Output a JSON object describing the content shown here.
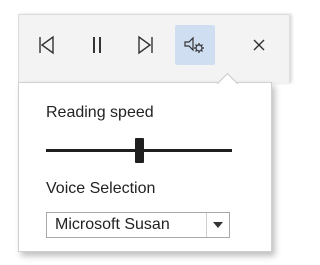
{
  "toolbar": {
    "buttons": [
      {
        "icon": "previous-icon",
        "label": "Previous"
      },
      {
        "icon": "pause-icon",
        "label": "Pause"
      },
      {
        "icon": "next-icon",
        "label": "Next"
      },
      {
        "icon": "voice-settings-icon",
        "label": "Voice settings",
        "active": true
      },
      {
        "icon": "close-icon",
        "label": "Close"
      }
    ],
    "active_color": "#cfdff1"
  },
  "settings_panel": {
    "reading_speed_label": "Reading speed",
    "reading_speed_value": 0.5,
    "voice_selection_label": "Voice Selection",
    "voice_selected": "Microsoft Susan"
  }
}
